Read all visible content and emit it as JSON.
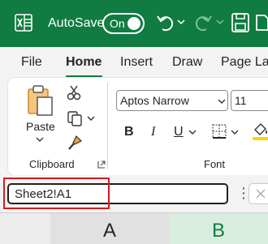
{
  "titlebar": {
    "autosave_label": "AutoSave",
    "toggle_state": "On",
    "icons": [
      "excel-logo-icon",
      "undo-icon",
      "chevron-down-icon",
      "redo-icon",
      "chevron-down-icon",
      "save-icon"
    ]
  },
  "tabs": [
    "File",
    "Home",
    "Insert",
    "Draw",
    "Page La"
  ],
  "ribbon": {
    "clipboard": {
      "paste_label": "Paste",
      "group_label": "Clipboard"
    },
    "font": {
      "font_name": "Aptos Narrow",
      "font_size": "11",
      "bold": "B",
      "italic": "I",
      "underline": "U",
      "group_label": "Font"
    }
  },
  "formula_bar": {
    "name_box_value": "Sheet2!A1"
  },
  "columns": [
    "A",
    "B"
  ],
  "colors": {
    "brand_green": "#107c41",
    "highlight_red": "#d81b1b"
  }
}
